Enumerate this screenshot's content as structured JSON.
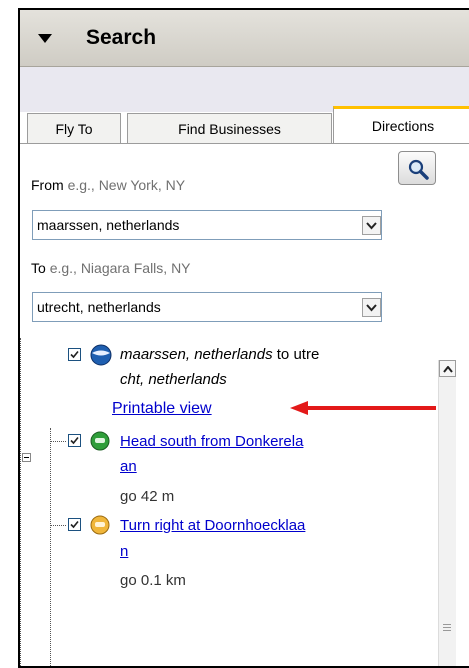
{
  "search": {
    "title": "Search"
  },
  "tabs": [
    {
      "label": "Fly To"
    },
    {
      "label": "Find Businesses"
    },
    {
      "label": "Directions"
    }
  ],
  "from": {
    "label": "From",
    "hint": "e.g., New York, NY",
    "value": "maarssen, netherlands"
  },
  "to": {
    "label": "To",
    "hint": "e.g., Niagara Falls, NY",
    "value": "utrecht, netherlands"
  },
  "result": {
    "line1_a": "maarssen, netherlands",
    "line1_b": " to utre",
    "line2": "cht, netherlands",
    "printable": "Printable view"
  },
  "steps": [
    {
      "text_line1": "Head south from Donkerela",
      "text_line2": "an",
      "distance": "go 42 m"
    },
    {
      "text_line1": "Turn right at Doornhoecklaa",
      "text_line2": "n",
      "distance": "go 0.1 km"
    }
  ],
  "colors": {
    "arrow": "#e31919",
    "link": "#0000cc",
    "active_tab_accent": "#ffc000"
  },
  "icons": [
    "collapse-triangle-icon",
    "dropdown-arrow-icon",
    "magnifier-icon",
    "earth-icon",
    "green-car-icon",
    "yellow-car-icon",
    "red-arrow-icon"
  ]
}
